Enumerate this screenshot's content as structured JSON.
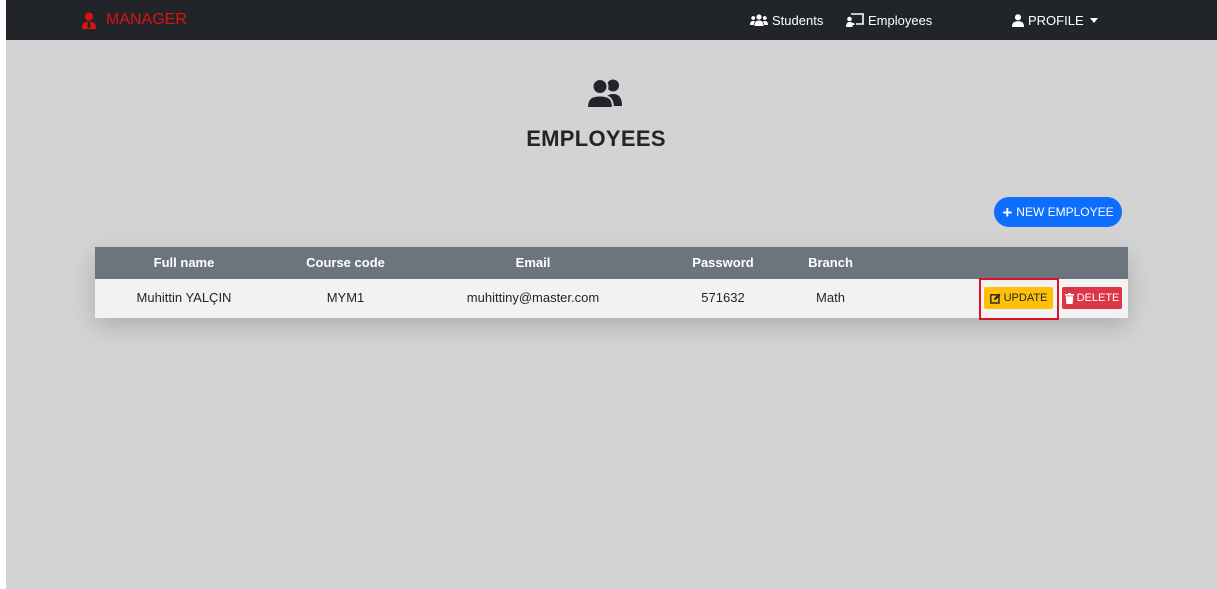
{
  "navbar": {
    "brand": "MANAGER",
    "brand_icon": "user-tie-icon",
    "links": [
      {
        "label": "Students",
        "icon": "users-icon"
      },
      {
        "label": "Employees",
        "icon": "chalkboard-teacher-icon"
      }
    ],
    "profile": {
      "label": "PROFILE",
      "icon": "user-icon"
    }
  },
  "page": {
    "icon": "user-friends-icon",
    "title": "EMPLOYEES",
    "new_button": "NEW EMPLOYEE"
  },
  "table": {
    "columns": [
      "Full name",
      "Course code",
      "Email",
      "Password",
      "Branch"
    ],
    "rows": [
      {
        "full_name": "Muhittin YALÇIN",
        "course_code": "MYM1",
        "email": "muhittiny@master.com",
        "password": "571632",
        "branch": "Math",
        "update_label": "UPDATE",
        "delete_label": "DELETE"
      }
    ]
  },
  "colors": {
    "navbar_bg": "#212529",
    "brand": "#e01010",
    "page_bg": "#d3d3d3",
    "primary": "#0d6efd",
    "table_header": "#6c757d",
    "warning": "#ffc107",
    "danger": "#dc3545",
    "highlight": "#e0102a"
  }
}
